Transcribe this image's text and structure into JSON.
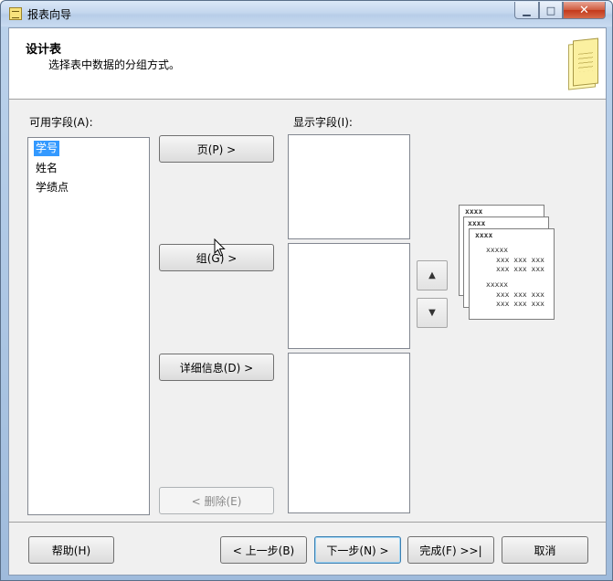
{
  "window": {
    "title": "报表向导",
    "min_glyph": "▁",
    "max_glyph": "□",
    "close_glyph": "✕"
  },
  "header": {
    "title": "设计表",
    "subtitle": "选择表中数据的分组方式。"
  },
  "available": {
    "label": "可用字段(A):",
    "items": [
      "学号",
      "姓名",
      "学绩点"
    ],
    "selected_index": 0
  },
  "display": {
    "label": "显示字段(I):"
  },
  "buttons": {
    "page": "页(P) >",
    "group": "组(G) >",
    "details": "详细信息(D)  >",
    "remove": "< 删除(E)",
    "move_up_glyph": "▲",
    "move_down_glyph": "▼"
  },
  "footer": {
    "help": "帮助(H)",
    "back": "< 上一步(B)",
    "next": "下一步(N) >",
    "finish": "完成(F) >>|",
    "cancel": "取消"
  },
  "preview": {
    "page1_header": "xxxx",
    "page2_header": "xxxx",
    "page3_header": "xxxx",
    "group_label_1": "xxxxx",
    "detail_row_1": "xxx xxx xxx",
    "detail_row_2": "xxx xxx xxx",
    "group_label_2": "xxxxx",
    "detail_row_3": "xxx xxx xxx",
    "detail_row_4": "xxx xxx xxx"
  }
}
